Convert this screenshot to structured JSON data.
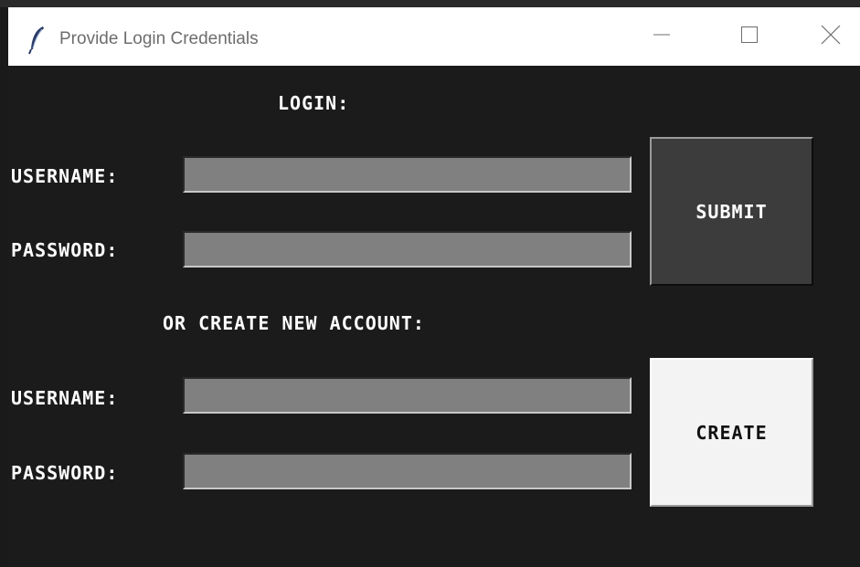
{
  "window": {
    "title": "Provide Login Credentials",
    "icon": "feather-icon",
    "controls": {
      "minimize_icon": "minimize-icon",
      "maximize_icon": "maximize-icon",
      "close_icon": "close-icon"
    }
  },
  "login": {
    "heading": "LOGIN:",
    "username_label": "USERNAME:",
    "username_value": "",
    "password_label": "PASSWORD:",
    "password_value": "",
    "submit_label": "SUBMIT"
  },
  "create": {
    "heading": "OR CREATE NEW ACCOUNT:",
    "username_label": "USERNAME:",
    "username_value": "",
    "password_label": "PASSWORD:",
    "password_value": "",
    "create_label": "CREATE"
  },
  "colors": {
    "background": "#1b1b1b",
    "field": "#808080",
    "submit_button": "#3c3c3c",
    "create_button": "#f3f3f3"
  }
}
